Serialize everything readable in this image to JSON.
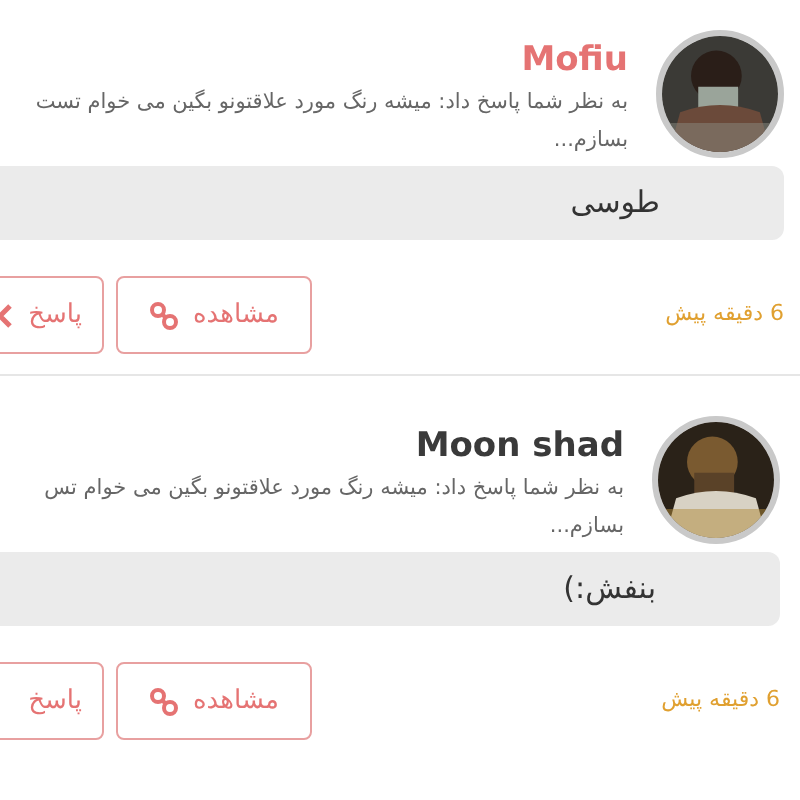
{
  "notifications": [
    {
      "name": "Mofiu",
      "color": "#e57373",
      "message_lines": [
        "به نظر شما پاسخ داد: میشه رنگ مورد علاقتونو بگین می خوام تست",
        "بسازم..."
      ],
      "answer": "طوسی",
      "time": "6 دقیقه پیش",
      "view_label": "مشاهده",
      "reply_label": "پاسخ"
    },
    {
      "name": "Moon shad",
      "color": "#3a3a3a",
      "message_lines": [
        "به نظر شما پاسخ داد: میشه رنگ مورد علاقتونو بگین می خوام تس",
        "بسازم..."
      ],
      "answer": "بنفش:)",
      "time": "6 دقیقه پیش",
      "view_label": "مشاهده",
      "reply_label": "پاسخ"
    }
  ]
}
